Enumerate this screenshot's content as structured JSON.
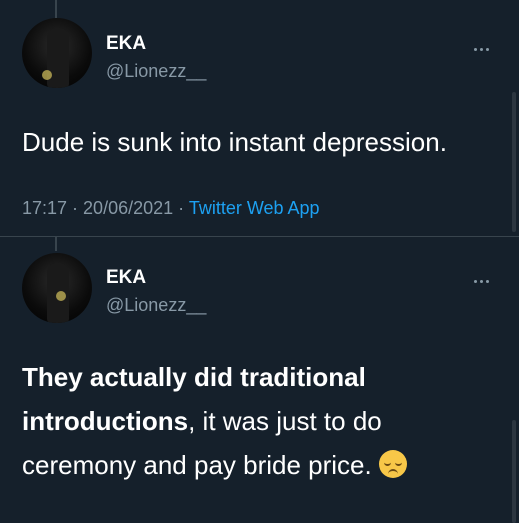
{
  "tweets": [
    {
      "author_name": "EKA",
      "handle": "@Lionezz__",
      "text": "Dude is sunk into instant depression.",
      "time": "17:17",
      "date": "20/06/2021",
      "source": "Twitter Web App",
      "separator": " · "
    },
    {
      "author_name": "EKA",
      "handle": "@Lionezz__",
      "text_bold": "They actually did traditional introductions",
      "text_rest": ", it was just to do ceremony and pay bride price.",
      "emoji": "pensive-face"
    }
  ],
  "more_icon": "more-horizontal-icon"
}
